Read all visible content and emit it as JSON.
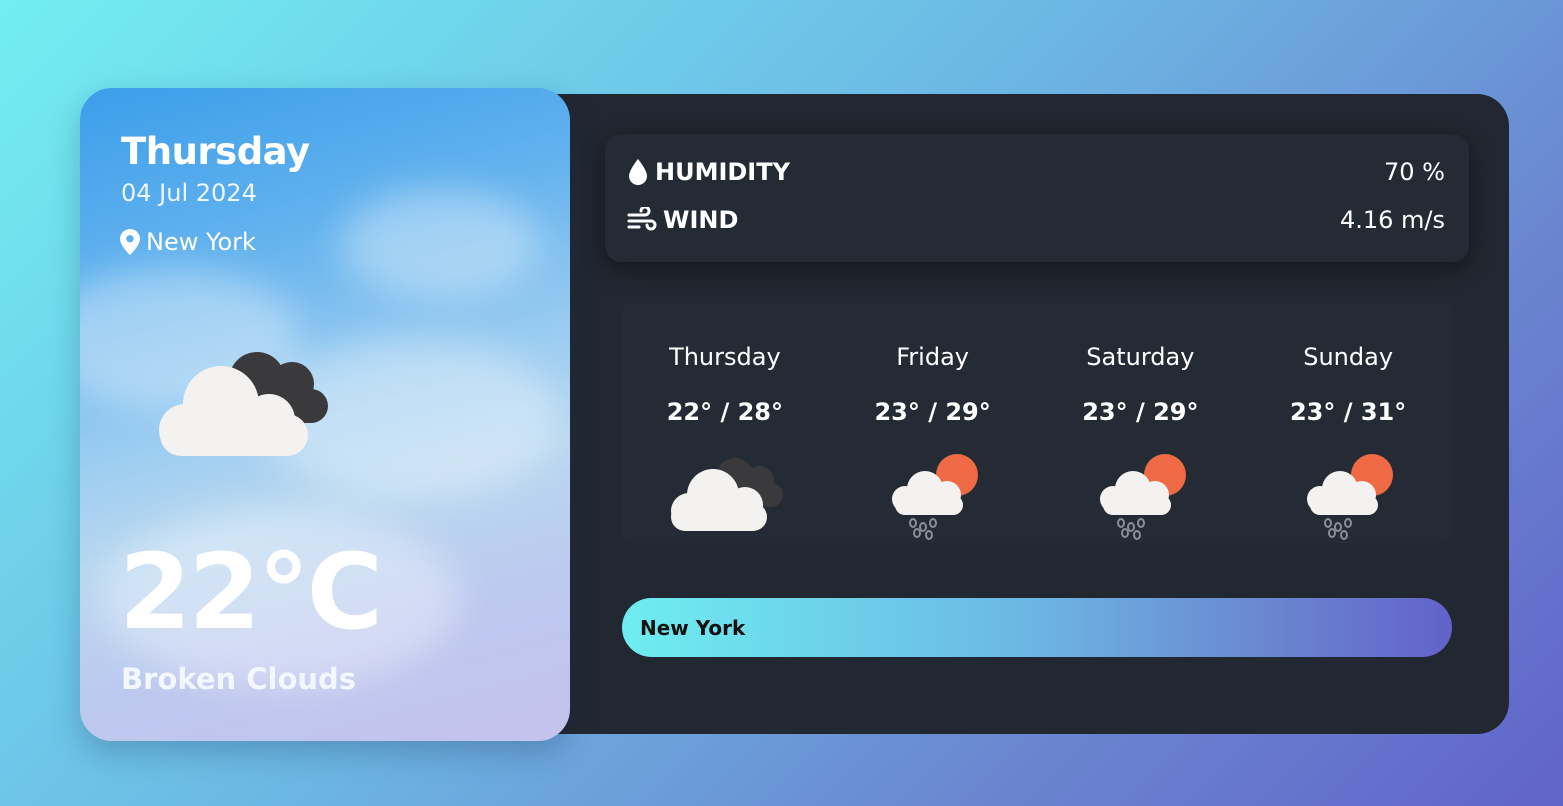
{
  "current": {
    "day": "Thursday",
    "date": "04 Jul 2024",
    "location": "New York",
    "temperature": "22°C",
    "description": "Broken Clouds",
    "icon": "broken-clouds-icon"
  },
  "stats": {
    "humidity": {
      "label": "HUMIDITY",
      "value": "70 %",
      "icon": "water-drop-icon"
    },
    "wind": {
      "label": "WIND",
      "value": "4.16 m/s",
      "icon": "wind-icon"
    }
  },
  "forecast": [
    {
      "day": "Thursday",
      "temps": "22° / 28°",
      "icon": "broken-clouds-icon"
    },
    {
      "day": "Friday",
      "temps": "23° / 29°",
      "icon": "sun-rain-icon"
    },
    {
      "day": "Saturday",
      "temps": "23° / 29°",
      "icon": "sun-rain-icon"
    },
    {
      "day": "Sunday",
      "temps": "23° / 31°",
      "icon": "sun-rain-icon"
    }
  ],
  "search": {
    "value": "New York"
  },
  "colors": {
    "panel": "#222831",
    "sun": "#ef6a45",
    "cloud_light": "#f3f2f1",
    "cloud_dark": "#3a3a3c",
    "accent_start": "#6eedf0",
    "accent_end": "#6262c9"
  }
}
